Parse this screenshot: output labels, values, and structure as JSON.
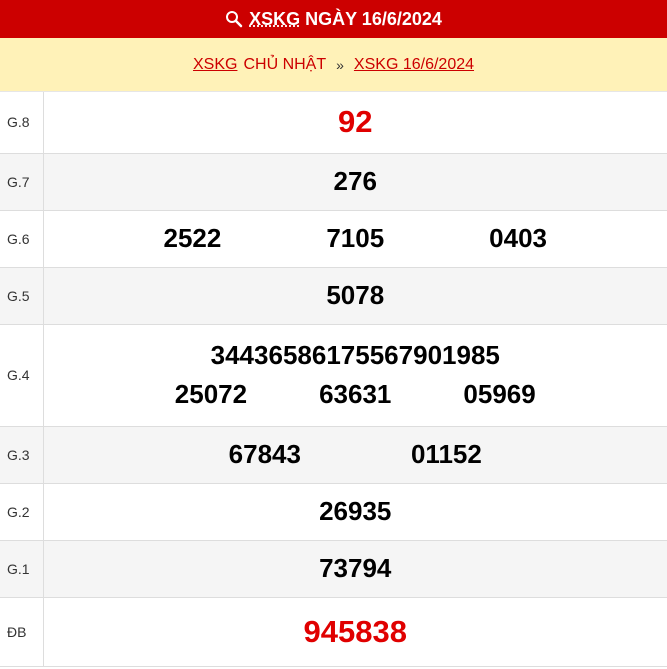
{
  "header": {
    "abbr": "XSKG",
    "title": "NGÀY 16/6/2024",
    "icon": "search-icon"
  },
  "breadcrumb": {
    "link1": "XSKG",
    "text1": "CHỦ NHẬT",
    "separator": "»",
    "link2": "XSKG 16/6/2024"
  },
  "results": {
    "g8": {
      "label": "G.8",
      "numbers": [
        "92"
      ]
    },
    "g7": {
      "label": "G.7",
      "numbers": [
        "276"
      ]
    },
    "g6": {
      "label": "G.6",
      "numbers": [
        "2522",
        "7105",
        "0403"
      ]
    },
    "g5": {
      "label": "G.5",
      "numbers": [
        "5078"
      ]
    },
    "g4": {
      "label": "G.4",
      "numbers": [
        "34436",
        "58617",
        "55679",
        "01985",
        "25072",
        "63631",
        "05969"
      ]
    },
    "g3": {
      "label": "G.3",
      "numbers": [
        "67843",
        "01152"
      ]
    },
    "g2": {
      "label": "G.2",
      "numbers": [
        "26935"
      ]
    },
    "g1": {
      "label": "G.1",
      "numbers": [
        "73794"
      ]
    },
    "db": {
      "label": "ĐB",
      "numbers": [
        "945838"
      ]
    }
  },
  "colors": {
    "header_bg": "#cc0000",
    "breadcrumb_bg": "#fff2b8",
    "highlight": "#e00000"
  }
}
